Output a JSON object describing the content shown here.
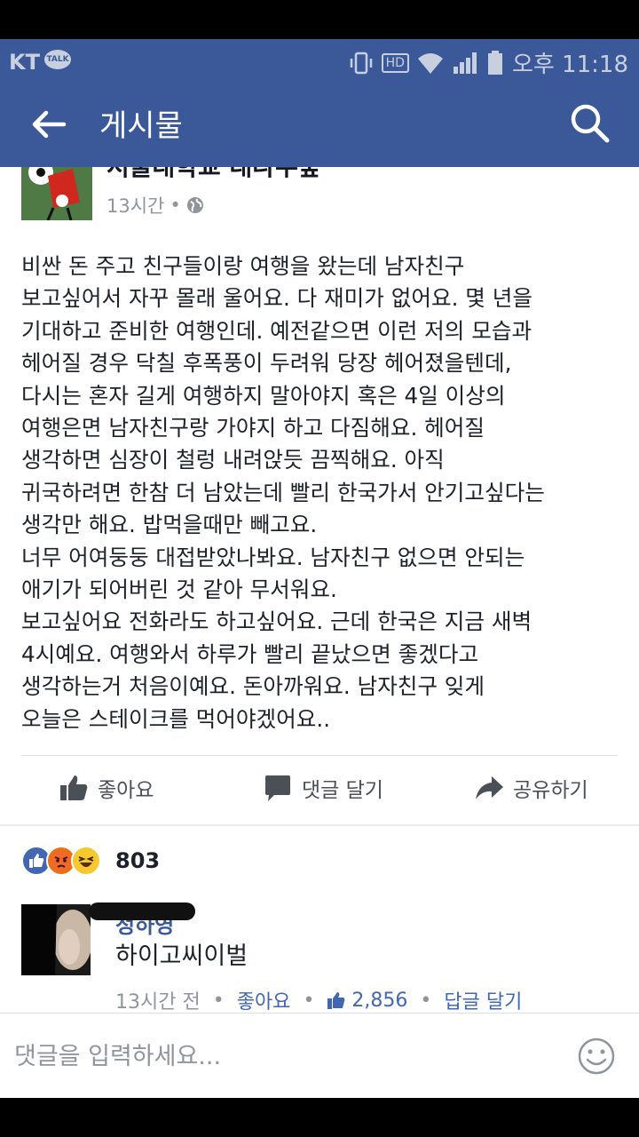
{
  "status_bar": {
    "carrier": "KT",
    "talk_badge": "TALK",
    "hd": "HD",
    "time": "오후 11:18"
  },
  "app_bar": {
    "title": "게시물",
    "back_icon": "arrow-left-icon",
    "search_icon": "search-icon"
  },
  "post": {
    "page_name": "서울대학교 대나무숲",
    "time": "13시간",
    "body": "비싼 돈 주고 친구들이랑 여행을 왔는데 남자친구\n보고싶어서 자꾸 몰래 울어요. 다 재미가 없어요. 몇 년을\n기대하고 준비한 여행인데. 예전같으면 이런 저의 모습과\n헤어질 경우 닥칠 후폭풍이 두려워 당장 헤어졌을텐데,\n다시는 혼자 길게 여행하지 말아야지 혹은 4일 이상의\n여행은면 남자친구랑 가야지 하고 다짐해요. 헤어질\n생각하면 심장이 철렁 내려앉듯 끔찍해요. 아직\n귀국하려면 한참 더 남았는데 빨리 한국가서 안기고싶다는\n생각만 해요. 밥먹을때만 빼고요.\n너무 어여둥둥 대접받았나봐요. 남자친구 없으면 안되는\n애기가 되어버린 것 같아 무서워요.\n보고싶어요 전화라도 하고싶어요. 근데 한국은 지금 새벽\n4시예요. 여행와서 하루가 빨리 끝났으면 좋겠다고\n생각하는거 처음이예요. 돈아까워요. 남자친구 잊게\n오늘은 스테이크를 먹어야겠어요..",
    "actions": {
      "like": "좋아요",
      "comment": "댓글 달기",
      "share": "공유하기"
    },
    "reaction_count": "803"
  },
  "comment": {
    "name": "정하영",
    "text": "하이고씨이벌",
    "time": "13시간 전",
    "like_link": "좋아요",
    "like_count": "2,856",
    "reply_link": "답글 달기"
  },
  "composer": {
    "placeholder": "댓글을 입력하세요..."
  },
  "colors": {
    "brand": "#3b5998",
    "link": "#4267b2",
    "secondary_text": "#90949c"
  }
}
